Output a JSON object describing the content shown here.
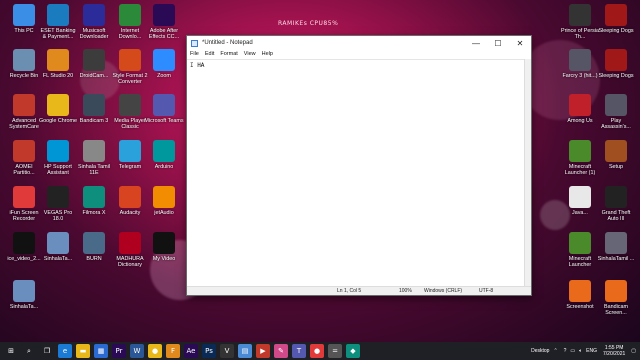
{
  "recording_label": "RAMIKEs CPU85%",
  "desktop_icons_left": [
    {
      "label": "This PC",
      "icon": "pc-icon",
      "color": "#3a8ee6"
    },
    {
      "label": "ESET Banking & Payment...",
      "icon": "eset-icon",
      "color": "#1b7bbf"
    },
    {
      "label": "Musicsoft Downloader",
      "icon": "musicsoft-icon",
      "color": "#2b2b9a"
    },
    {
      "label": "Internet Downlo...",
      "icon": "idm-icon",
      "color": "#2a8a3a"
    },
    {
      "label": "Adobe After Effects CC...",
      "icon": "after-effects-icon",
      "color": "#2a0a55"
    },
    {
      "label": "Recycle Bin",
      "icon": "recycle-bin-icon",
      "color": "#6b8fb0"
    },
    {
      "label": "FL Studio 20",
      "icon": "fl-studio-icon",
      "color": "#e08a1e"
    },
    {
      "label": "DroidCam...",
      "icon": "droidcam-icon",
      "color": "#3c3c3c"
    },
    {
      "label": "Style Format 2 Converter",
      "icon": "style-format-icon",
      "color": "#d44a1a"
    },
    {
      "label": "Zoom",
      "icon": "zoom-icon",
      "color": "#2d8cff"
    },
    {
      "label": "Advanced SystemCare",
      "icon": "systemcare-icon",
      "color": "#c0392b"
    },
    {
      "label": "Google Chrome",
      "icon": "chrome-icon",
      "color": "#e8b71a"
    },
    {
      "label": "Bandicam 3",
      "icon": "bandicam-icon",
      "color": "#3a4a5a"
    },
    {
      "label": "Media Player Classic",
      "icon": "mpc-icon",
      "color": "#444"
    },
    {
      "label": "Microsoft Teams",
      "icon": "teams-icon",
      "color": "#5558af"
    },
    {
      "label": "AOMEI Partitio...",
      "icon": "aomei-icon",
      "color": "#c0392b"
    },
    {
      "label": "HP Support Assistant",
      "icon": "hp-icon",
      "color": "#0096d6"
    },
    {
      "label": "Sinhala Tamil 11E",
      "icon": "sinhala-tamil-icon",
      "color": "#888"
    },
    {
      "label": "Telegram",
      "icon": "telegram-icon",
      "color": "#2aa1da"
    },
    {
      "label": "Arduino",
      "icon": "arduino-icon",
      "color": "#00979d"
    },
    {
      "label": "iFun Screen Recorder",
      "icon": "ifun-icon",
      "color": "#e03a3a"
    },
    {
      "label": "VEGAS Pro 18.0",
      "icon": "vegas-icon",
      "color": "#222"
    },
    {
      "label": "Filmora X",
      "icon": "filmora-icon",
      "color": "#0e8f7d"
    },
    {
      "label": "Audacity",
      "icon": "audacity-icon",
      "color": "#d8441f"
    },
    {
      "label": "jetAudio",
      "icon": "jetaudio-icon",
      "color": "#f28c00"
    },
    {
      "label": "ice_video_2...",
      "icon": "video-file-icon",
      "color": "#111"
    },
    {
      "label": "SinhalaTa...",
      "icon": "sinhala-file-icon",
      "color": "#6a8fbf"
    },
    {
      "label": "BURN",
      "icon": "burn-icon",
      "color": "#4a6a8a"
    },
    {
      "label": "MADHURA Dictionary",
      "icon": "madhura-icon",
      "color": "#b00020"
    },
    {
      "label": "My Video",
      "icon": "my-video-icon",
      "color": "#111"
    },
    {
      "label": "SinhalaTa...",
      "icon": "sinhala-file-icon-2",
      "color": "#6a8fbf"
    }
  ],
  "desktop_icons_right": [
    {
      "label": "Prince of Persia Th...",
      "icon": "prince-of-persia-icon",
      "color": "#333"
    },
    {
      "label": "Sleeping Dogs",
      "icon": "sleeping-dogs-icon",
      "color": "#a01818"
    },
    {
      "label": "Farcry 3 (hit...)",
      "icon": "farcry3-icon",
      "color": "#556"
    },
    {
      "label": "Sleeping Dogs",
      "icon": "sleeping-dogs-icon-2",
      "color": "#a01818"
    },
    {
      "label": "Among Us",
      "icon": "among-us-icon",
      "color": "#c0202a"
    },
    {
      "label": "Play Assassin's...",
      "icon": "assassins-icon",
      "color": "#556"
    },
    {
      "label": "Minecraft Launcher (1)",
      "icon": "minecraft-icon",
      "color": "#4a8a2a"
    },
    {
      "label": "Setup",
      "icon": "setup-icon",
      "color": "#a05020"
    },
    {
      "label": "Java...",
      "icon": "java-icon",
      "color": "#e8e8e8"
    },
    {
      "label": "Grand Theft Auto III",
      "icon": "gta3-icon",
      "color": "#222"
    },
    {
      "label": "Minecraft Launcher",
      "icon": "minecraft-launcher-icon",
      "color": "#4a8a2a"
    },
    {
      "label": "SinhalaTamil ...",
      "icon": "sinhala-icon-r",
      "color": "#667"
    },
    {
      "label": "Screenshot",
      "icon": "screenshot-icon",
      "color": "#e86a1a"
    },
    {
      "label": "Bandicam Screen...",
      "icon": "bandicam-screen-icon",
      "color": "#e86a1a"
    }
  ],
  "notepad": {
    "title": "*Untitled - Notepad",
    "menu": [
      "File",
      "Edit",
      "Format",
      "View",
      "Help"
    ],
    "content": "HA",
    "status": {
      "position": "Ln 1, Col 5",
      "zoom": "100%",
      "eol": "Windows (CRLF)",
      "encoding": "UTF-8"
    },
    "minimize": "—",
    "maximize": "☐",
    "close": "✕"
  },
  "taskbar": {
    "desktop_label": "Desktop",
    "language": "ENG",
    "time": "1:55 PM",
    "date": "7/20/2021",
    "apps": [
      {
        "icon": "start-icon",
        "glyph": "⊞",
        "color": "#1f1f26"
      },
      {
        "icon": "search-icon",
        "glyph": "⌕",
        "color": "#1f1f26"
      },
      {
        "icon": "task-view-icon",
        "glyph": "❐",
        "color": "#1f1f26"
      },
      {
        "icon": "edge-icon",
        "glyph": "e",
        "color": "#1b7ad4"
      },
      {
        "icon": "file-explorer-icon",
        "glyph": "▬",
        "color": "#e8b71a"
      },
      {
        "icon": "store-icon",
        "glyph": "▦",
        "color": "#2b6ad1"
      },
      {
        "icon": "premiere-icon",
        "glyph": "Pr",
        "color": "#2a0a55"
      },
      {
        "icon": "word-icon",
        "glyph": "W",
        "color": "#2b5797"
      },
      {
        "icon": "chrome-task-icon",
        "glyph": "●",
        "color": "#e8b71a"
      },
      {
        "icon": "fl-task-icon",
        "glyph": "F",
        "color": "#e08a1e"
      },
      {
        "icon": "ae-task-icon",
        "glyph": "Ae",
        "color": "#2a0a55"
      },
      {
        "icon": "ps-task-icon",
        "glyph": "Ps",
        "color": "#0a2a55"
      },
      {
        "icon": "vegas-task-icon",
        "glyph": "V",
        "color": "#333"
      },
      {
        "icon": "notepad-task-icon",
        "glyph": "▤",
        "color": "#4a8ad4"
      },
      {
        "icon": "media-task-icon",
        "glyph": "▶",
        "color": "#c0392b"
      },
      {
        "icon": "paint-task-icon",
        "glyph": "✎",
        "color": "#d04a8a"
      },
      {
        "icon": "teams-task-icon",
        "glyph": "T",
        "color": "#5558af"
      },
      {
        "icon": "bandicam-task-icon",
        "glyph": "●",
        "color": "#e03a3a"
      },
      {
        "icon": "calc-task-icon",
        "glyph": "=",
        "color": "#555"
      },
      {
        "icon": "filmora-task-icon",
        "glyph": "◆",
        "color": "#0e8f7d"
      }
    ]
  }
}
